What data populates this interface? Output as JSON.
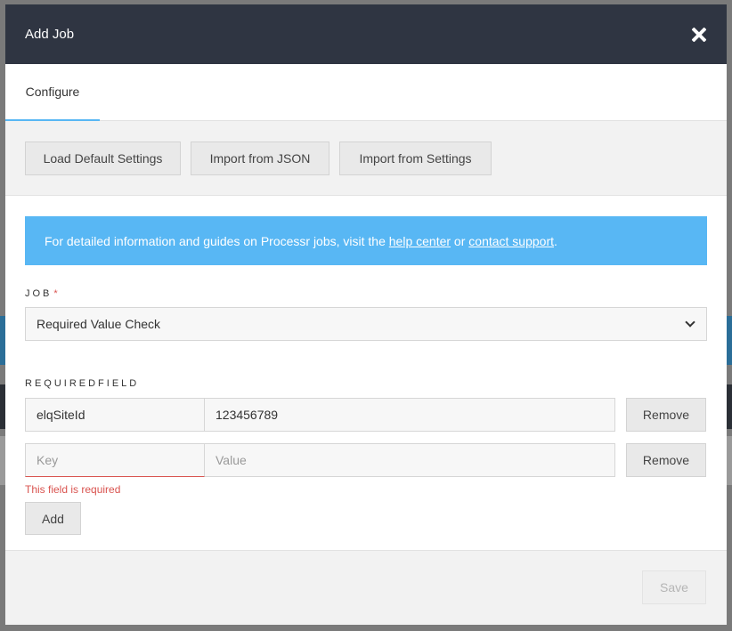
{
  "modal": {
    "title": "Add Job"
  },
  "tabs": [
    {
      "label": "Configure",
      "active": true
    }
  ],
  "toolbar": {
    "load_default": "Load Default Settings",
    "import_json": "Import from JSON",
    "import_settings": "Import from Settings"
  },
  "info": {
    "prefix": "For detailed information and guides on Processr jobs, visit the ",
    "help_link": "help center",
    "middle": " or ",
    "support_link": "contact support",
    "suffix": "."
  },
  "job": {
    "label": "JOB",
    "required_mark": "*",
    "selected": "Required Value Check"
  },
  "required_field": {
    "label": "REQUIREDFIELD",
    "rows": [
      {
        "key": "elqSiteId",
        "value": "123456789",
        "remove_label": "Remove"
      },
      {
        "key": "",
        "value": "",
        "key_placeholder": "Key",
        "value_placeholder": "Value",
        "remove_label": "Remove"
      }
    ],
    "error": "This field is required",
    "add_label": "Add"
  },
  "footer": {
    "save_label": "Save"
  },
  "colors": {
    "header_bg": "#2f3542",
    "accent": "#58b7f4",
    "error": "#d9534f"
  }
}
